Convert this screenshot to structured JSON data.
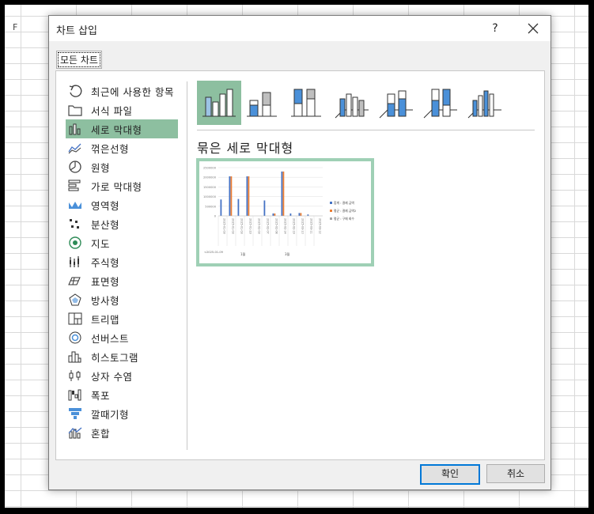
{
  "sheet": {
    "column_fragment": "F"
  },
  "dialog": {
    "title": "차트 삽입",
    "help": "?",
    "tab_label": "모든 차트",
    "chart_types": [
      {
        "label": "최근에 사용한 항목",
        "icon": "recent-icon"
      },
      {
        "label": "서식 파일",
        "icon": "folder-icon"
      },
      {
        "label": "세로 막대형",
        "icon": "column-chart-icon",
        "selected": true
      },
      {
        "label": "꺾은선형",
        "icon": "line-chart-icon"
      },
      {
        "label": "원형",
        "icon": "pie-chart-icon"
      },
      {
        "label": "가로 막대형",
        "icon": "bar-chart-icon"
      },
      {
        "label": "영역형",
        "icon": "area-chart-icon"
      },
      {
        "label": "분산형",
        "icon": "scatter-chart-icon"
      },
      {
        "label": "지도",
        "icon": "map-chart-icon"
      },
      {
        "label": "주식형",
        "icon": "stock-chart-icon"
      },
      {
        "label": "표면형",
        "icon": "surface-chart-icon"
      },
      {
        "label": "방사형",
        "icon": "radar-chart-icon"
      },
      {
        "label": "트리맵",
        "icon": "treemap-chart-icon"
      },
      {
        "label": "선버스트",
        "icon": "sunburst-chart-icon"
      },
      {
        "label": "히스토그램",
        "icon": "histogram-chart-icon"
      },
      {
        "label": "상자 수염",
        "icon": "box-whisker-chart-icon"
      },
      {
        "label": "폭포",
        "icon": "waterfall-chart-icon"
      },
      {
        "label": "깔때기형",
        "icon": "funnel-chart-icon"
      },
      {
        "label": "혼합",
        "icon": "combo-chart-icon"
      }
    ],
    "subtypes": [
      {
        "name": "clustered-column-icon",
        "selected": true
      },
      {
        "name": "stacked-column-icon"
      },
      {
        "name": "100-stacked-column-icon"
      },
      {
        "name": "3d-clustered-column-icon"
      },
      {
        "name": "3d-stacked-column-icon"
      },
      {
        "name": "3d-100-stacked-column-icon"
      },
      {
        "name": "3d-column-icon"
      }
    ],
    "subtype_title": "묶은 세로 막대형",
    "preview": {
      "y_ticks": [
        "2500000",
        "2000000",
        "1500000",
        "1000000",
        "500000",
        "0"
      ],
      "x_dates": [
        "2025-01-03",
        "2025-01-03",
        "2025-01-03",
        "2025-01-23",
        "2025-02-03",
        "2025-02-07",
        "2025-02-08",
        "2025-02-14",
        "2025-02-19",
        "2025-03-10",
        "2025-03-11",
        "2025-03-12"
      ],
      "group_labels": [
        "1월",
        "3월"
      ],
      "group_caption": "<2025-01-09",
      "legend": [
        "합계 : 결제 금액",
        "평균 : 결제 금액2",
        "평균 : 구매 회수"
      ],
      "colors": [
        "#4472c4",
        "#ed7d31",
        "#a5a5a5"
      ]
    },
    "ok_label": "확인",
    "cancel_label": "취소"
  }
}
